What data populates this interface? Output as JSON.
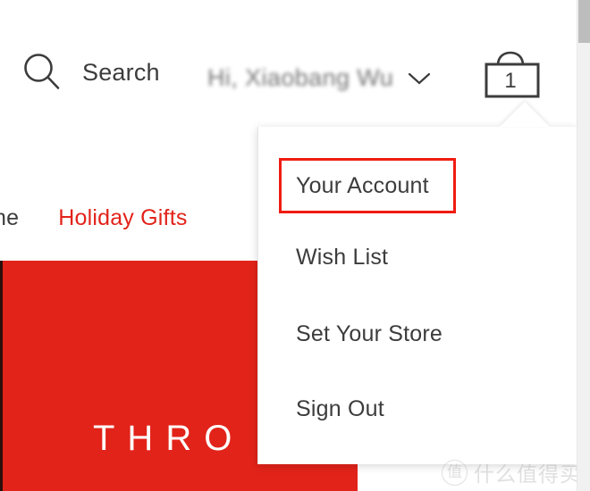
{
  "header": {
    "search": {
      "icon": "search-icon",
      "label": "Search"
    },
    "account_greeting": {
      "text": "Hi, Xiaobang Wu",
      "chevron_icon": "chevron-down-icon",
      "blurred": true
    },
    "cart": {
      "icon": "shopping-bag-icon",
      "count": "1"
    }
  },
  "nav": {
    "items": [
      {
        "label": "ome",
        "color": "#3c3c3c"
      },
      {
        "label": "Holiday Gifts",
        "color": "#e2231a"
      }
    ]
  },
  "hero": {
    "title": "THRO",
    "background_color": "#e2231a",
    "text_color": "#ffffff"
  },
  "dropdown": {
    "items": [
      {
        "label": "Your Account",
        "highlighted": true
      },
      {
        "label": "Wish List",
        "highlighted": false
      },
      {
        "label": "Set Your Store",
        "highlighted": false
      },
      {
        "label": "Sign Out",
        "highlighted": false
      }
    ],
    "highlight_color": "#f01c12"
  },
  "watermark": {
    "badge": "值",
    "text": "什么值得买"
  },
  "scrollbar": {
    "thumb_color": "#bdbdbd",
    "track_color": "#f1f1f1"
  }
}
